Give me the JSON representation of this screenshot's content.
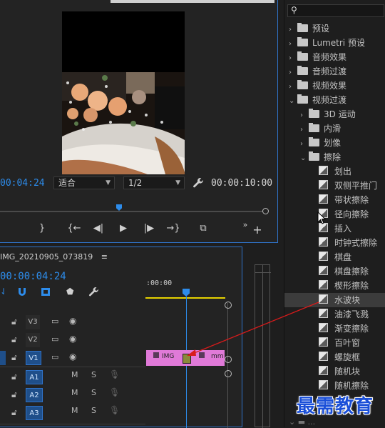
{
  "monitor": {
    "current_time": "00:04:24",
    "fit_value": "适合",
    "resolution_value": "1/2",
    "duration": "00:00:10:00"
  },
  "timeline": {
    "sequence_name": "IMG_20210905_073819",
    "playhead_time": "00:00:04:24",
    "ruler_label": ":00:00",
    "tracks": [
      {
        "label": "V3",
        "type": "video"
      },
      {
        "label": "V2",
        "type": "video"
      },
      {
        "label": "V1",
        "type": "video"
      },
      {
        "label": "A1",
        "type": "audio",
        "m": "M",
        "s": "S"
      },
      {
        "label": "A2",
        "type": "audio",
        "m": "M",
        "s": "S"
      },
      {
        "label": "A3",
        "type": "audio",
        "m": "M",
        "s": "S"
      }
    ],
    "clip1": "IMG",
    "clip2": "mm"
  },
  "effects": {
    "search_placeholder": "",
    "items": [
      {
        "label": "预设",
        "level": 0,
        "kind": "folder",
        "chev": "›"
      },
      {
        "label": "Lumetri 预设",
        "level": 0,
        "kind": "folder",
        "chev": "›"
      },
      {
        "label": "音频效果",
        "level": 0,
        "kind": "folder",
        "chev": "›"
      },
      {
        "label": "音频过渡",
        "level": 0,
        "kind": "folder",
        "chev": "›"
      },
      {
        "label": "视频效果",
        "level": 0,
        "kind": "folder",
        "chev": "›"
      },
      {
        "label": "视频过渡",
        "level": 0,
        "kind": "folder",
        "chev": "⌄"
      },
      {
        "label": "3D 运动",
        "level": 1,
        "kind": "folder",
        "chev": "›"
      },
      {
        "label": "内滑",
        "level": 1,
        "kind": "folder",
        "chev": "›"
      },
      {
        "label": "划像",
        "level": 1,
        "kind": "folder",
        "chev": "›"
      },
      {
        "label": "擦除",
        "level": 1,
        "kind": "folder",
        "chev": "⌄"
      },
      {
        "label": "划出",
        "level": 2,
        "kind": "fx"
      },
      {
        "label": "双侧平推门",
        "level": 2,
        "kind": "fx"
      },
      {
        "label": "带状擦除",
        "level": 2,
        "kind": "fx"
      },
      {
        "label": "径向擦除",
        "level": 2,
        "kind": "fx"
      },
      {
        "label": "插入",
        "level": 2,
        "kind": "fx"
      },
      {
        "label": "时钟式擦除",
        "level": 2,
        "kind": "fx"
      },
      {
        "label": "棋盘",
        "level": 2,
        "kind": "fx"
      },
      {
        "label": "棋盘擦除",
        "level": 2,
        "kind": "fx"
      },
      {
        "label": "楔形擦除",
        "level": 2,
        "kind": "fx"
      },
      {
        "label": "水波块",
        "level": 2,
        "kind": "fx",
        "selected": true
      },
      {
        "label": "油漆飞溅",
        "level": 2,
        "kind": "fx"
      },
      {
        "label": "渐变擦除",
        "level": 2,
        "kind": "fx"
      },
      {
        "label": "百叶窗",
        "level": 2,
        "kind": "fx"
      },
      {
        "label": "螺旋框",
        "level": 2,
        "kind": "fx"
      },
      {
        "label": "随机块",
        "level": 2,
        "kind": "fx"
      },
      {
        "label": "随机擦除",
        "level": 2,
        "kind": "fx"
      }
    ]
  },
  "watermark": "最需教育",
  "colors": {
    "accent": "#2d8ceb",
    "clip": "#e07ad8",
    "arrow": "#d81b1b",
    "watermark": "#1a4fd8"
  }
}
